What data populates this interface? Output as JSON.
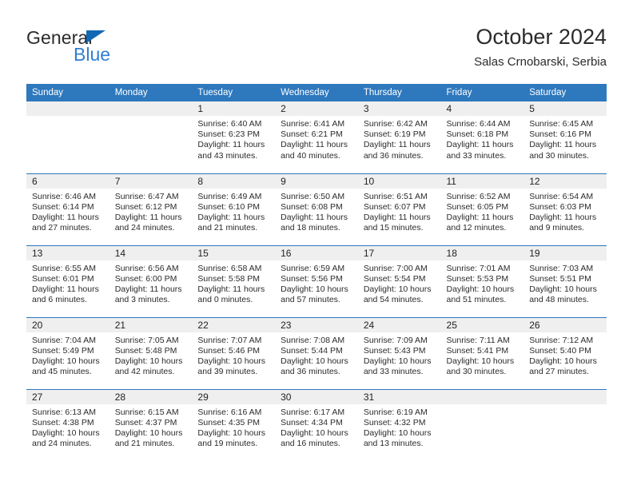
{
  "brand": {
    "name_part1": "General",
    "name_part2": "Blue",
    "triangle_color": "#1268b3",
    "blue_text_color": "#2f7fd0"
  },
  "header": {
    "title": "October 2024",
    "subtitle": "Salas Crnobarski, Serbia",
    "accent_color": "#2e78bd"
  },
  "weekdays": [
    "Sunday",
    "Monday",
    "Tuesday",
    "Wednesday",
    "Thursday",
    "Friday",
    "Saturday"
  ],
  "labels": {
    "sunrise_prefix": "Sunrise:",
    "sunset_prefix": "Sunset:",
    "daylight_prefix": "Daylight:"
  },
  "weeks": [
    [
      {
        "day": "",
        "sunrise": "",
        "sunset": "",
        "daylight": ""
      },
      {
        "day": "",
        "sunrise": "",
        "sunset": "",
        "daylight": ""
      },
      {
        "day": "1",
        "sunrise": "Sunrise: 6:40 AM",
        "sunset": "Sunset: 6:23 PM",
        "daylight": "Daylight: 11 hours and 43 minutes."
      },
      {
        "day": "2",
        "sunrise": "Sunrise: 6:41 AM",
        "sunset": "Sunset: 6:21 PM",
        "daylight": "Daylight: 11 hours and 40 minutes."
      },
      {
        "day": "3",
        "sunrise": "Sunrise: 6:42 AM",
        "sunset": "Sunset: 6:19 PM",
        "daylight": "Daylight: 11 hours and 36 minutes."
      },
      {
        "day": "4",
        "sunrise": "Sunrise: 6:44 AM",
        "sunset": "Sunset: 6:18 PM",
        "daylight": "Daylight: 11 hours and 33 minutes."
      },
      {
        "day": "5",
        "sunrise": "Sunrise: 6:45 AM",
        "sunset": "Sunset: 6:16 PM",
        "daylight": "Daylight: 11 hours and 30 minutes."
      }
    ],
    [
      {
        "day": "6",
        "sunrise": "Sunrise: 6:46 AM",
        "sunset": "Sunset: 6:14 PM",
        "daylight": "Daylight: 11 hours and 27 minutes."
      },
      {
        "day": "7",
        "sunrise": "Sunrise: 6:47 AM",
        "sunset": "Sunset: 6:12 PM",
        "daylight": "Daylight: 11 hours and 24 minutes."
      },
      {
        "day": "8",
        "sunrise": "Sunrise: 6:49 AM",
        "sunset": "Sunset: 6:10 PM",
        "daylight": "Daylight: 11 hours and 21 minutes."
      },
      {
        "day": "9",
        "sunrise": "Sunrise: 6:50 AM",
        "sunset": "Sunset: 6:08 PM",
        "daylight": "Daylight: 11 hours and 18 minutes."
      },
      {
        "day": "10",
        "sunrise": "Sunrise: 6:51 AM",
        "sunset": "Sunset: 6:07 PM",
        "daylight": "Daylight: 11 hours and 15 minutes."
      },
      {
        "day": "11",
        "sunrise": "Sunrise: 6:52 AM",
        "sunset": "Sunset: 6:05 PM",
        "daylight": "Daylight: 11 hours and 12 minutes."
      },
      {
        "day": "12",
        "sunrise": "Sunrise: 6:54 AM",
        "sunset": "Sunset: 6:03 PM",
        "daylight": "Daylight: 11 hours and 9 minutes."
      }
    ],
    [
      {
        "day": "13",
        "sunrise": "Sunrise: 6:55 AM",
        "sunset": "Sunset: 6:01 PM",
        "daylight": "Daylight: 11 hours and 6 minutes."
      },
      {
        "day": "14",
        "sunrise": "Sunrise: 6:56 AM",
        "sunset": "Sunset: 6:00 PM",
        "daylight": "Daylight: 11 hours and 3 minutes."
      },
      {
        "day": "15",
        "sunrise": "Sunrise: 6:58 AM",
        "sunset": "Sunset: 5:58 PM",
        "daylight": "Daylight: 11 hours and 0 minutes."
      },
      {
        "day": "16",
        "sunrise": "Sunrise: 6:59 AM",
        "sunset": "Sunset: 5:56 PM",
        "daylight": "Daylight: 10 hours and 57 minutes."
      },
      {
        "day": "17",
        "sunrise": "Sunrise: 7:00 AM",
        "sunset": "Sunset: 5:54 PM",
        "daylight": "Daylight: 10 hours and 54 minutes."
      },
      {
        "day": "18",
        "sunrise": "Sunrise: 7:01 AM",
        "sunset": "Sunset: 5:53 PM",
        "daylight": "Daylight: 10 hours and 51 minutes."
      },
      {
        "day": "19",
        "sunrise": "Sunrise: 7:03 AM",
        "sunset": "Sunset: 5:51 PM",
        "daylight": "Daylight: 10 hours and 48 minutes."
      }
    ],
    [
      {
        "day": "20",
        "sunrise": "Sunrise: 7:04 AM",
        "sunset": "Sunset: 5:49 PM",
        "daylight": "Daylight: 10 hours and 45 minutes."
      },
      {
        "day": "21",
        "sunrise": "Sunrise: 7:05 AM",
        "sunset": "Sunset: 5:48 PM",
        "daylight": "Daylight: 10 hours and 42 minutes."
      },
      {
        "day": "22",
        "sunrise": "Sunrise: 7:07 AM",
        "sunset": "Sunset: 5:46 PM",
        "daylight": "Daylight: 10 hours and 39 minutes."
      },
      {
        "day": "23",
        "sunrise": "Sunrise: 7:08 AM",
        "sunset": "Sunset: 5:44 PM",
        "daylight": "Daylight: 10 hours and 36 minutes."
      },
      {
        "day": "24",
        "sunrise": "Sunrise: 7:09 AM",
        "sunset": "Sunset: 5:43 PM",
        "daylight": "Daylight: 10 hours and 33 minutes."
      },
      {
        "day": "25",
        "sunrise": "Sunrise: 7:11 AM",
        "sunset": "Sunset: 5:41 PM",
        "daylight": "Daylight: 10 hours and 30 minutes."
      },
      {
        "day": "26",
        "sunrise": "Sunrise: 7:12 AM",
        "sunset": "Sunset: 5:40 PM",
        "daylight": "Daylight: 10 hours and 27 minutes."
      }
    ],
    [
      {
        "day": "27",
        "sunrise": "Sunrise: 6:13 AM",
        "sunset": "Sunset: 4:38 PM",
        "daylight": "Daylight: 10 hours and 24 minutes."
      },
      {
        "day": "28",
        "sunrise": "Sunrise: 6:15 AM",
        "sunset": "Sunset: 4:37 PM",
        "daylight": "Daylight: 10 hours and 21 minutes."
      },
      {
        "day": "29",
        "sunrise": "Sunrise: 6:16 AM",
        "sunset": "Sunset: 4:35 PM",
        "daylight": "Daylight: 10 hours and 19 minutes."
      },
      {
        "day": "30",
        "sunrise": "Sunrise: 6:17 AM",
        "sunset": "Sunset: 4:34 PM",
        "daylight": "Daylight: 10 hours and 16 minutes."
      },
      {
        "day": "31",
        "sunrise": "Sunrise: 6:19 AM",
        "sunset": "Sunset: 4:32 PM",
        "daylight": "Daylight: 10 hours and 13 minutes."
      },
      {
        "day": "",
        "sunrise": "",
        "sunset": "",
        "daylight": ""
      },
      {
        "day": "",
        "sunrise": "",
        "sunset": "",
        "daylight": ""
      }
    ]
  ]
}
